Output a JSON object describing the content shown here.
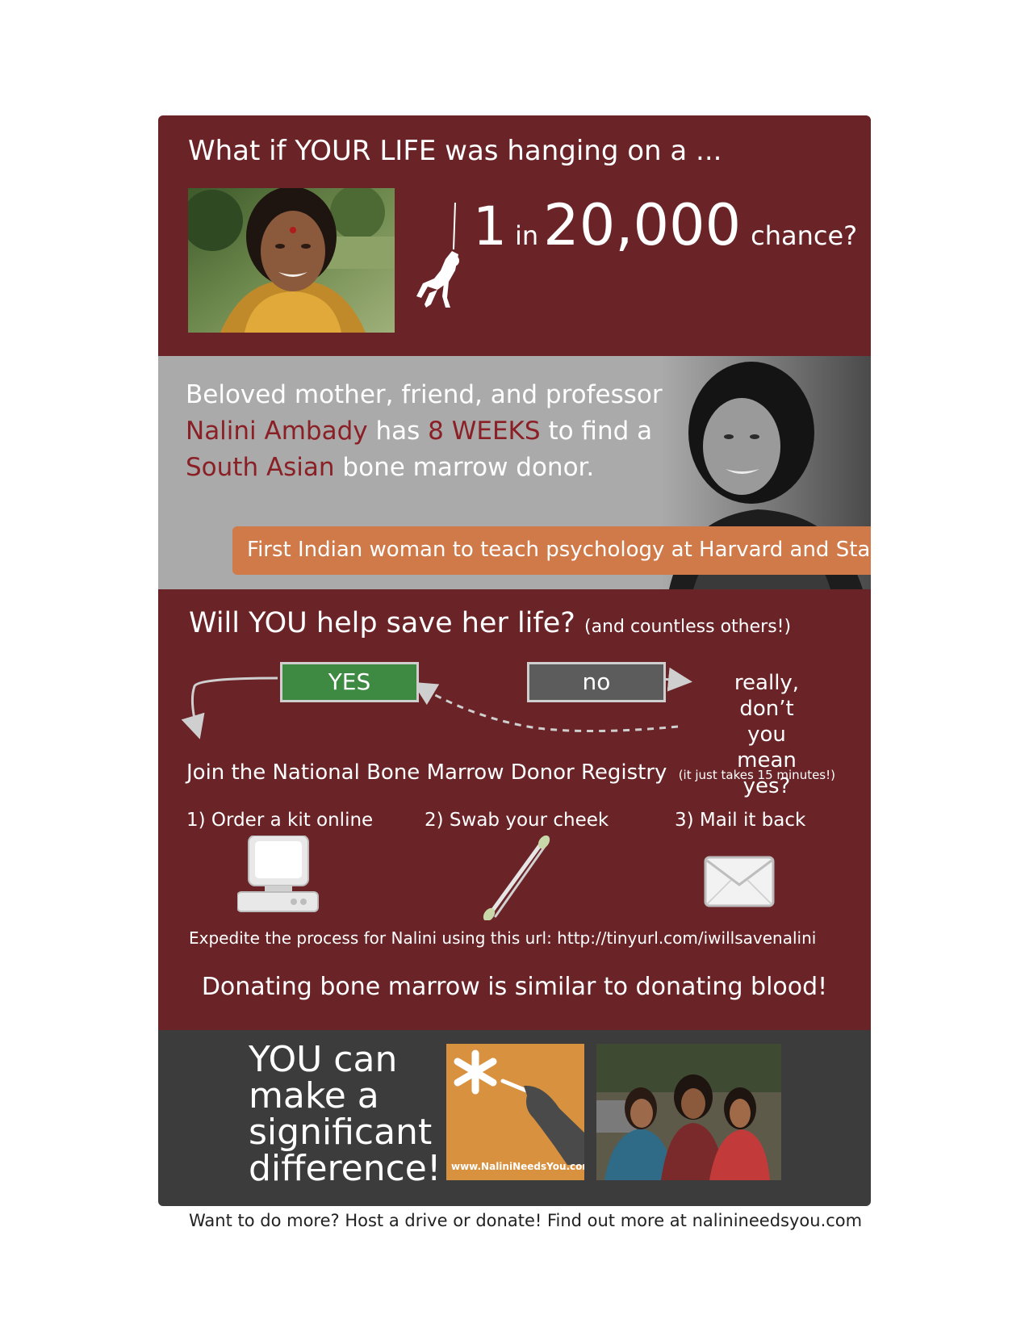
{
  "top": {
    "headline": "What if YOUR LIFE was hanging on a ...",
    "odds": {
      "one": "1",
      "in": "in",
      "number": "20,000",
      "word": "chance?"
    }
  },
  "middle": {
    "line1": "Beloved mother, friend, and professor",
    "name": "Nalini Ambady",
    "has": "has",
    "weeks": "8 WEEKS",
    "find": "to find a",
    "ethnicity": "South Asian",
    "donor": "bone marrow donor.",
    "banner": "First Indian woman to teach psychology at Harvard and Stanford"
  },
  "help": {
    "title": "Will YOU help save her life?",
    "subtitle": "(and countless others!)",
    "yes_label": "YES",
    "no_label": "no",
    "really_lines": [
      "really,",
      "don’t you",
      "mean yes?"
    ],
    "join": "Join the National Bone Marrow Donor Registry",
    "join_note": "(it just takes 15 minutes!)",
    "steps": [
      "1) Order a kit online",
      "2) Swab your cheek",
      "3) Mail it back"
    ],
    "expedite": "Expedite the process for Nalini using this url: http://tinyurl.com/iwillsavenalini",
    "donating": "Donating bone marrow is similar to donating blood!"
  },
  "bottom": {
    "you_can_lines": [
      "YOU can",
      "make a",
      "significant",
      "difference!"
    ],
    "promo_url": "www.NaliniNeedsYou.com"
  },
  "footer": "Want to do more? Host a drive or donate! Find out more at nalinineedsyou.com",
  "colors": {
    "maroon": "#6a2327",
    "gray_band": "#aaaaaa",
    "dark_band": "#3c3c3c",
    "orange": "#d07a4a",
    "yes_green": "#3f8a43",
    "no_gray": "#5c5c5c",
    "highlight_red": "#8a1f25",
    "promo_orange": "#d8913f"
  },
  "icons": [
    "climber-icon",
    "computer-icon",
    "cotton-swab-icon",
    "envelope-icon",
    "asterisk-icon",
    "hand-swab-icon"
  ]
}
